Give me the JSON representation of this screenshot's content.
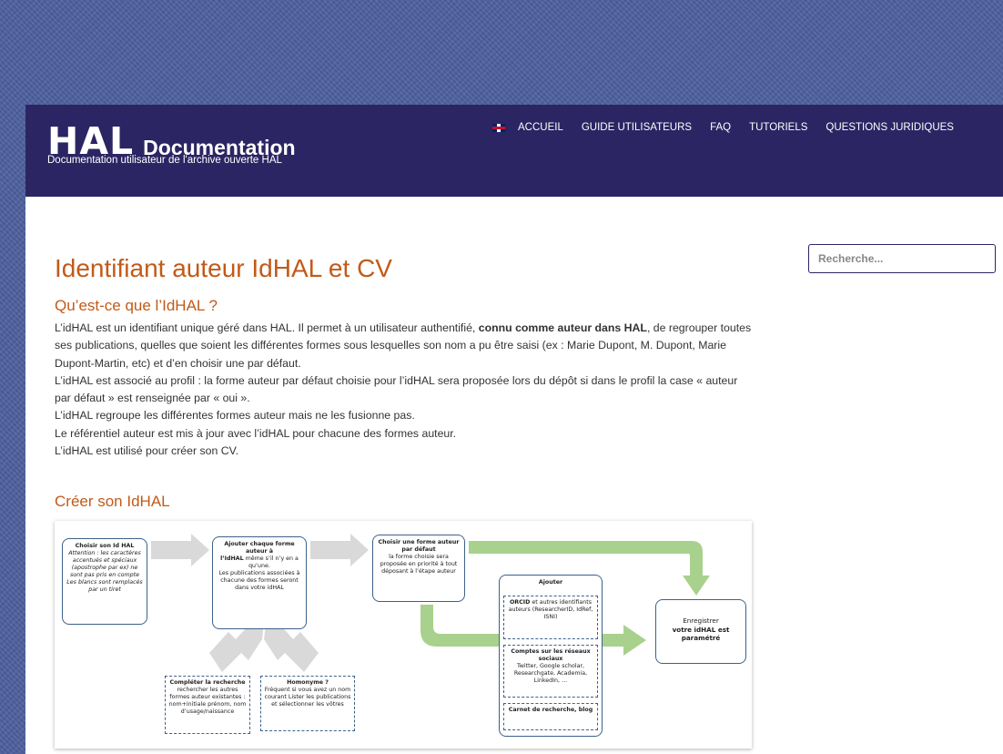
{
  "header": {
    "logo": "HAL",
    "logo_suffix": "Documentation",
    "tagline": "Documentation utilisateur de l'archive ouverte HAL"
  },
  "nav": {
    "flag_icon": "uk-flag-icon",
    "items": [
      {
        "label": "ACCUEIL"
      },
      {
        "label": "GUIDE UTILISATEURS"
      },
      {
        "label": "FAQ"
      },
      {
        "label": "TUTORIELS"
      },
      {
        "label": "QUESTIONS JURIDIQUES"
      }
    ]
  },
  "search": {
    "placeholder": "Recherche..."
  },
  "page": {
    "title": "Identifiant auteur IdHAL et CV",
    "section1": {
      "heading": "Qu’est-ce que l’IdHAL ?",
      "p1_before": "L’idHAL est un identifiant unique géré dans HAL. Il permet à un utilisateur authentifié, ",
      "p1_strong": "connu comme auteur dans HAL",
      "p1_after": ", de regrouper toutes ses publications, quelles que soient les différentes formes sous lesquelles son nom a pu être saisi (ex : Marie Dupont, M. Dupont, Marie Dupont-Martin, etc) et d’en choisir une par défaut.",
      "p2": "L’idHAL est associé au profil : la forme auteur par défaut choisie pour l’idHAL sera proposée lors du dépôt si dans le profil la case « auteur par défaut » est renseignée par « oui ».",
      "p3": "L’idHAL regroupe les différentes formes auteur mais ne les fusionne pas.",
      "p4": "Le référentiel auteur est mis à jour avec l’idHAL pour chacune des formes auteur.",
      "p5": "L’idHAL est utilisé pour créer son CV."
    },
    "section2": {
      "heading": "Créer son IdHAL"
    }
  },
  "diagram": {
    "colors": {
      "box_border": "#3d6189",
      "arrow_gray": "#d9d9d9",
      "arrow_green": "#a9d18e"
    },
    "box1": {
      "title": "Choisir son Id HAL",
      "body": "Attention : les caractères accentués et spéciaux (apostrophe par ex) ne sont pas pris en compte Les blancs sont remplacés par un tiret"
    },
    "box2": {
      "title": "Ajouter chaque forme auteur à",
      "title2": "l’IdHAL",
      "body1": " même s’il n’y en a qu’une.",
      "body2": "Les publications associées à chacune des formes seront dans votre idHAL"
    },
    "box3": {
      "title": "Choisir une forme auteur par défaut",
      "body": "la forme choisie sera proposée en priorité à tout déposant à l’étape auteur"
    },
    "box4": {
      "title": "Compléter la recherche",
      "body": "rechercher les autres formes auteur existantes : nom+initiale prénom, nom d’usage/naissance"
    },
    "box5": {
      "title": "Homonyme ?",
      "body": "Fréquent si vous avez un nom courant Lister les publications et sélectionner les vôtres"
    },
    "box6": {
      "title": "Ajouter",
      "sub1_title": "ORCID",
      "sub1_body": " et autres identifiants auteurs (ResearcherID, IdRef, ISNI)",
      "sub2_title": "Comptes sur les réseaux sociaux",
      "sub2_body": "Twitter, Google scholar, Researchgate, Academia, LinkedIn, …",
      "sub3_title": "Carnet de recherche, blog"
    },
    "box7": {
      "line1": "Enregistrer",
      "line2": "votre idHAL est paramétré"
    }
  }
}
